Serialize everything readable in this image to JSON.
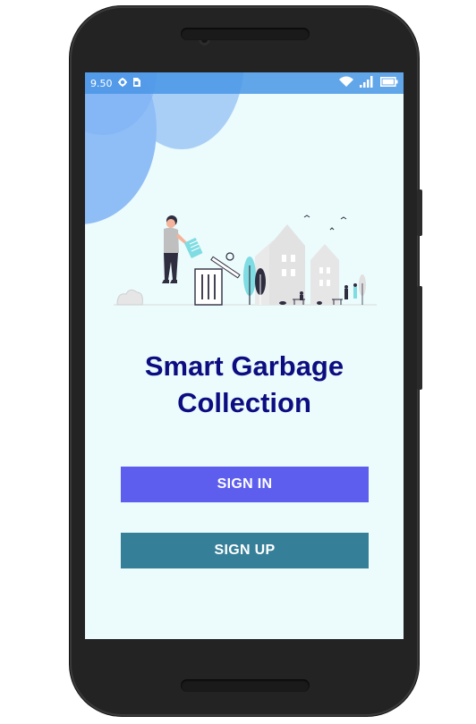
{
  "status_bar": {
    "time": "9.50",
    "icons": [
      "settings-icon",
      "sim-card-icon",
      "wifi-icon",
      "cellular-signal-icon",
      "battery-icon"
    ]
  },
  "app": {
    "title_line1": "Smart Garbage",
    "title_line2": "Collection"
  },
  "buttons": {
    "sign_in": "SIGN IN",
    "sign_up": "SIGN UP"
  },
  "colors": {
    "screen_background": "#ecfbfc",
    "title": "#0d0d82",
    "sign_in_button": "#5e5eee",
    "sign_up_button": "#367f98",
    "status_bar": "#4a96e6"
  }
}
